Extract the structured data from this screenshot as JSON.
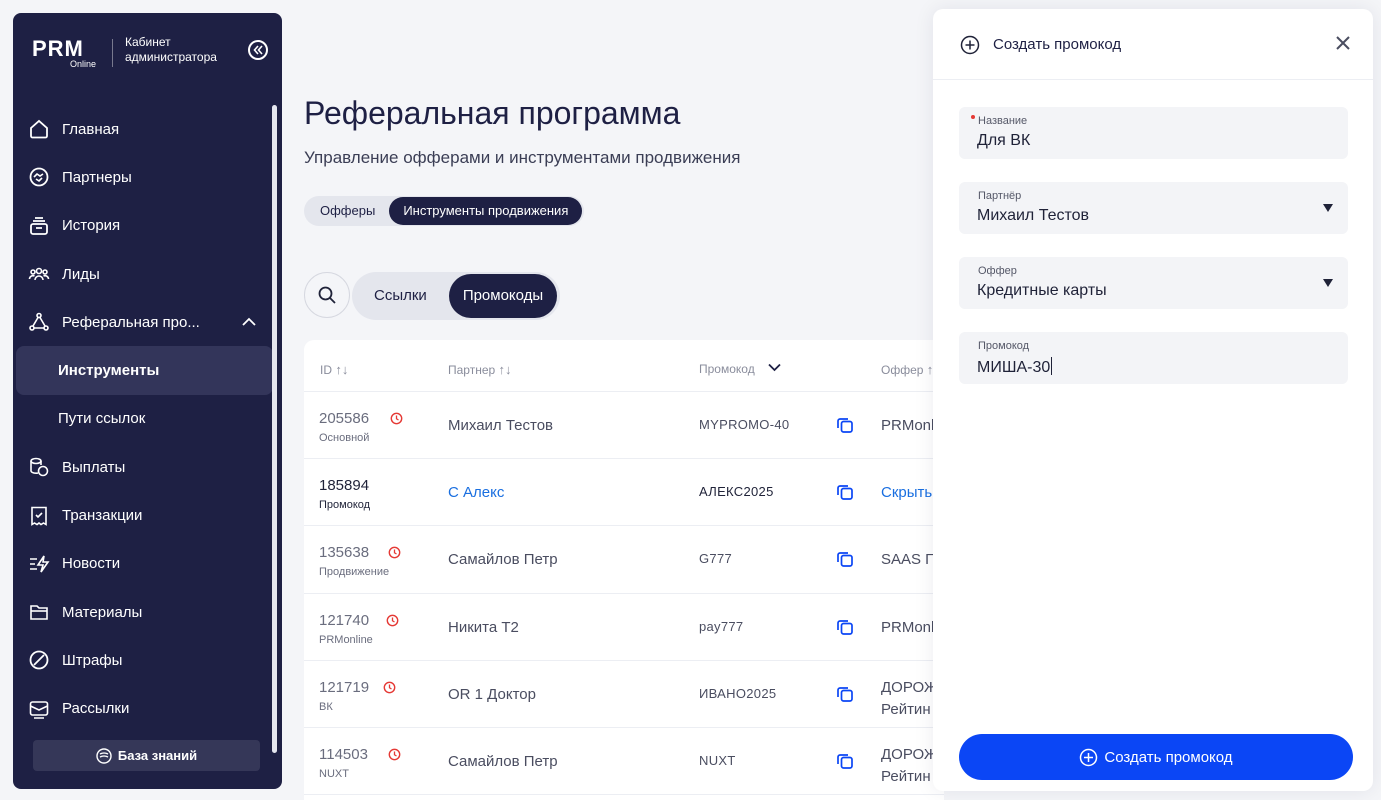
{
  "sidebar": {
    "logo_main": "PRM",
    "logo_sub": "Online",
    "cabinet_title": "Кабинет администратора",
    "items": [
      {
        "label": "Главная",
        "icon": "home-icon"
      },
      {
        "label": "Партнеры",
        "icon": "handshake-icon"
      },
      {
        "label": "История",
        "icon": "history-icon"
      },
      {
        "label": "Лиды",
        "icon": "users-icon"
      },
      {
        "label": "Реферальная про...",
        "icon": "network-icon"
      },
      {
        "label": "Инструменты"
      },
      {
        "label": "Пути ссылок"
      },
      {
        "label": "Выплаты",
        "icon": "coins-icon"
      },
      {
        "label": "Транзакции",
        "icon": "receipt-icon"
      },
      {
        "label": "Новости",
        "icon": "news-icon"
      },
      {
        "label": "Материалы",
        "icon": "folder-icon"
      },
      {
        "label": "Штрафы",
        "icon": "ban-icon"
      },
      {
        "label": "Рассылки",
        "icon": "mail-icon"
      }
    ],
    "knowledge_base": "База знаний"
  },
  "main": {
    "title": "Реферальная программа",
    "subtitle": "Управление офферами и инструментами продвижения",
    "tabs": [
      "Офферы",
      "Инструменты продвижения"
    ],
    "subtabs": [
      "Ссылки",
      "Промокоды"
    ],
    "table": {
      "headers": {
        "id": "ID",
        "partner": "Партнер",
        "promocode": "Промокод",
        "offer": "Оффер"
      },
      "rows": [
        {
          "id": "205586",
          "sub": "Основной",
          "partner": "Михаил Тестов",
          "code": "MYPROMO-40",
          "offer": "PRMonl",
          "offer2": ""
        },
        {
          "id": "185894",
          "sub": "Промокод",
          "partner": "С Алекс",
          "code": "АЛЕКС2025",
          "offer": "Скрыть",
          "offer2": ""
        },
        {
          "id": "135638",
          "sub": "Продвижение",
          "partner": "Самайлов Петр",
          "code": "G777",
          "offer": "SAAS П",
          "offer2": ""
        },
        {
          "id": "121740",
          "sub": "PRMonline",
          "partner": "Никита Т2",
          "code": "pay777",
          "offer": "PRMonl",
          "offer2": ""
        },
        {
          "id": "121719",
          "sub": "ВК",
          "partner": "OR 1 Доктор",
          "code": "ИВАНО2025",
          "offer": "ДОРОЖ",
          "offer2": "Рейтин"
        },
        {
          "id": "114503",
          "sub": "NUXT",
          "partner": "Самайлов Петр",
          "code": "NUXT",
          "offer": "ДОРОЖ",
          "offer2": "Рейтин"
        }
      ]
    }
  },
  "panel": {
    "title": "Создать промокод",
    "fields": {
      "name": {
        "label": "Название",
        "value": "Для ВК"
      },
      "partner": {
        "label": "Партнёр",
        "value": "Михаил Тестов"
      },
      "offer": {
        "label": "Оффер",
        "value": "Кредитные карты"
      },
      "code": {
        "label": "Промокод",
        "value": "МИША-30"
      }
    },
    "submit": "Создать промокод"
  },
  "colors": {
    "sidebar": "#1e2044",
    "accent": "#0b46f5",
    "link": "#1a6fe0",
    "alert": "#e53935"
  }
}
